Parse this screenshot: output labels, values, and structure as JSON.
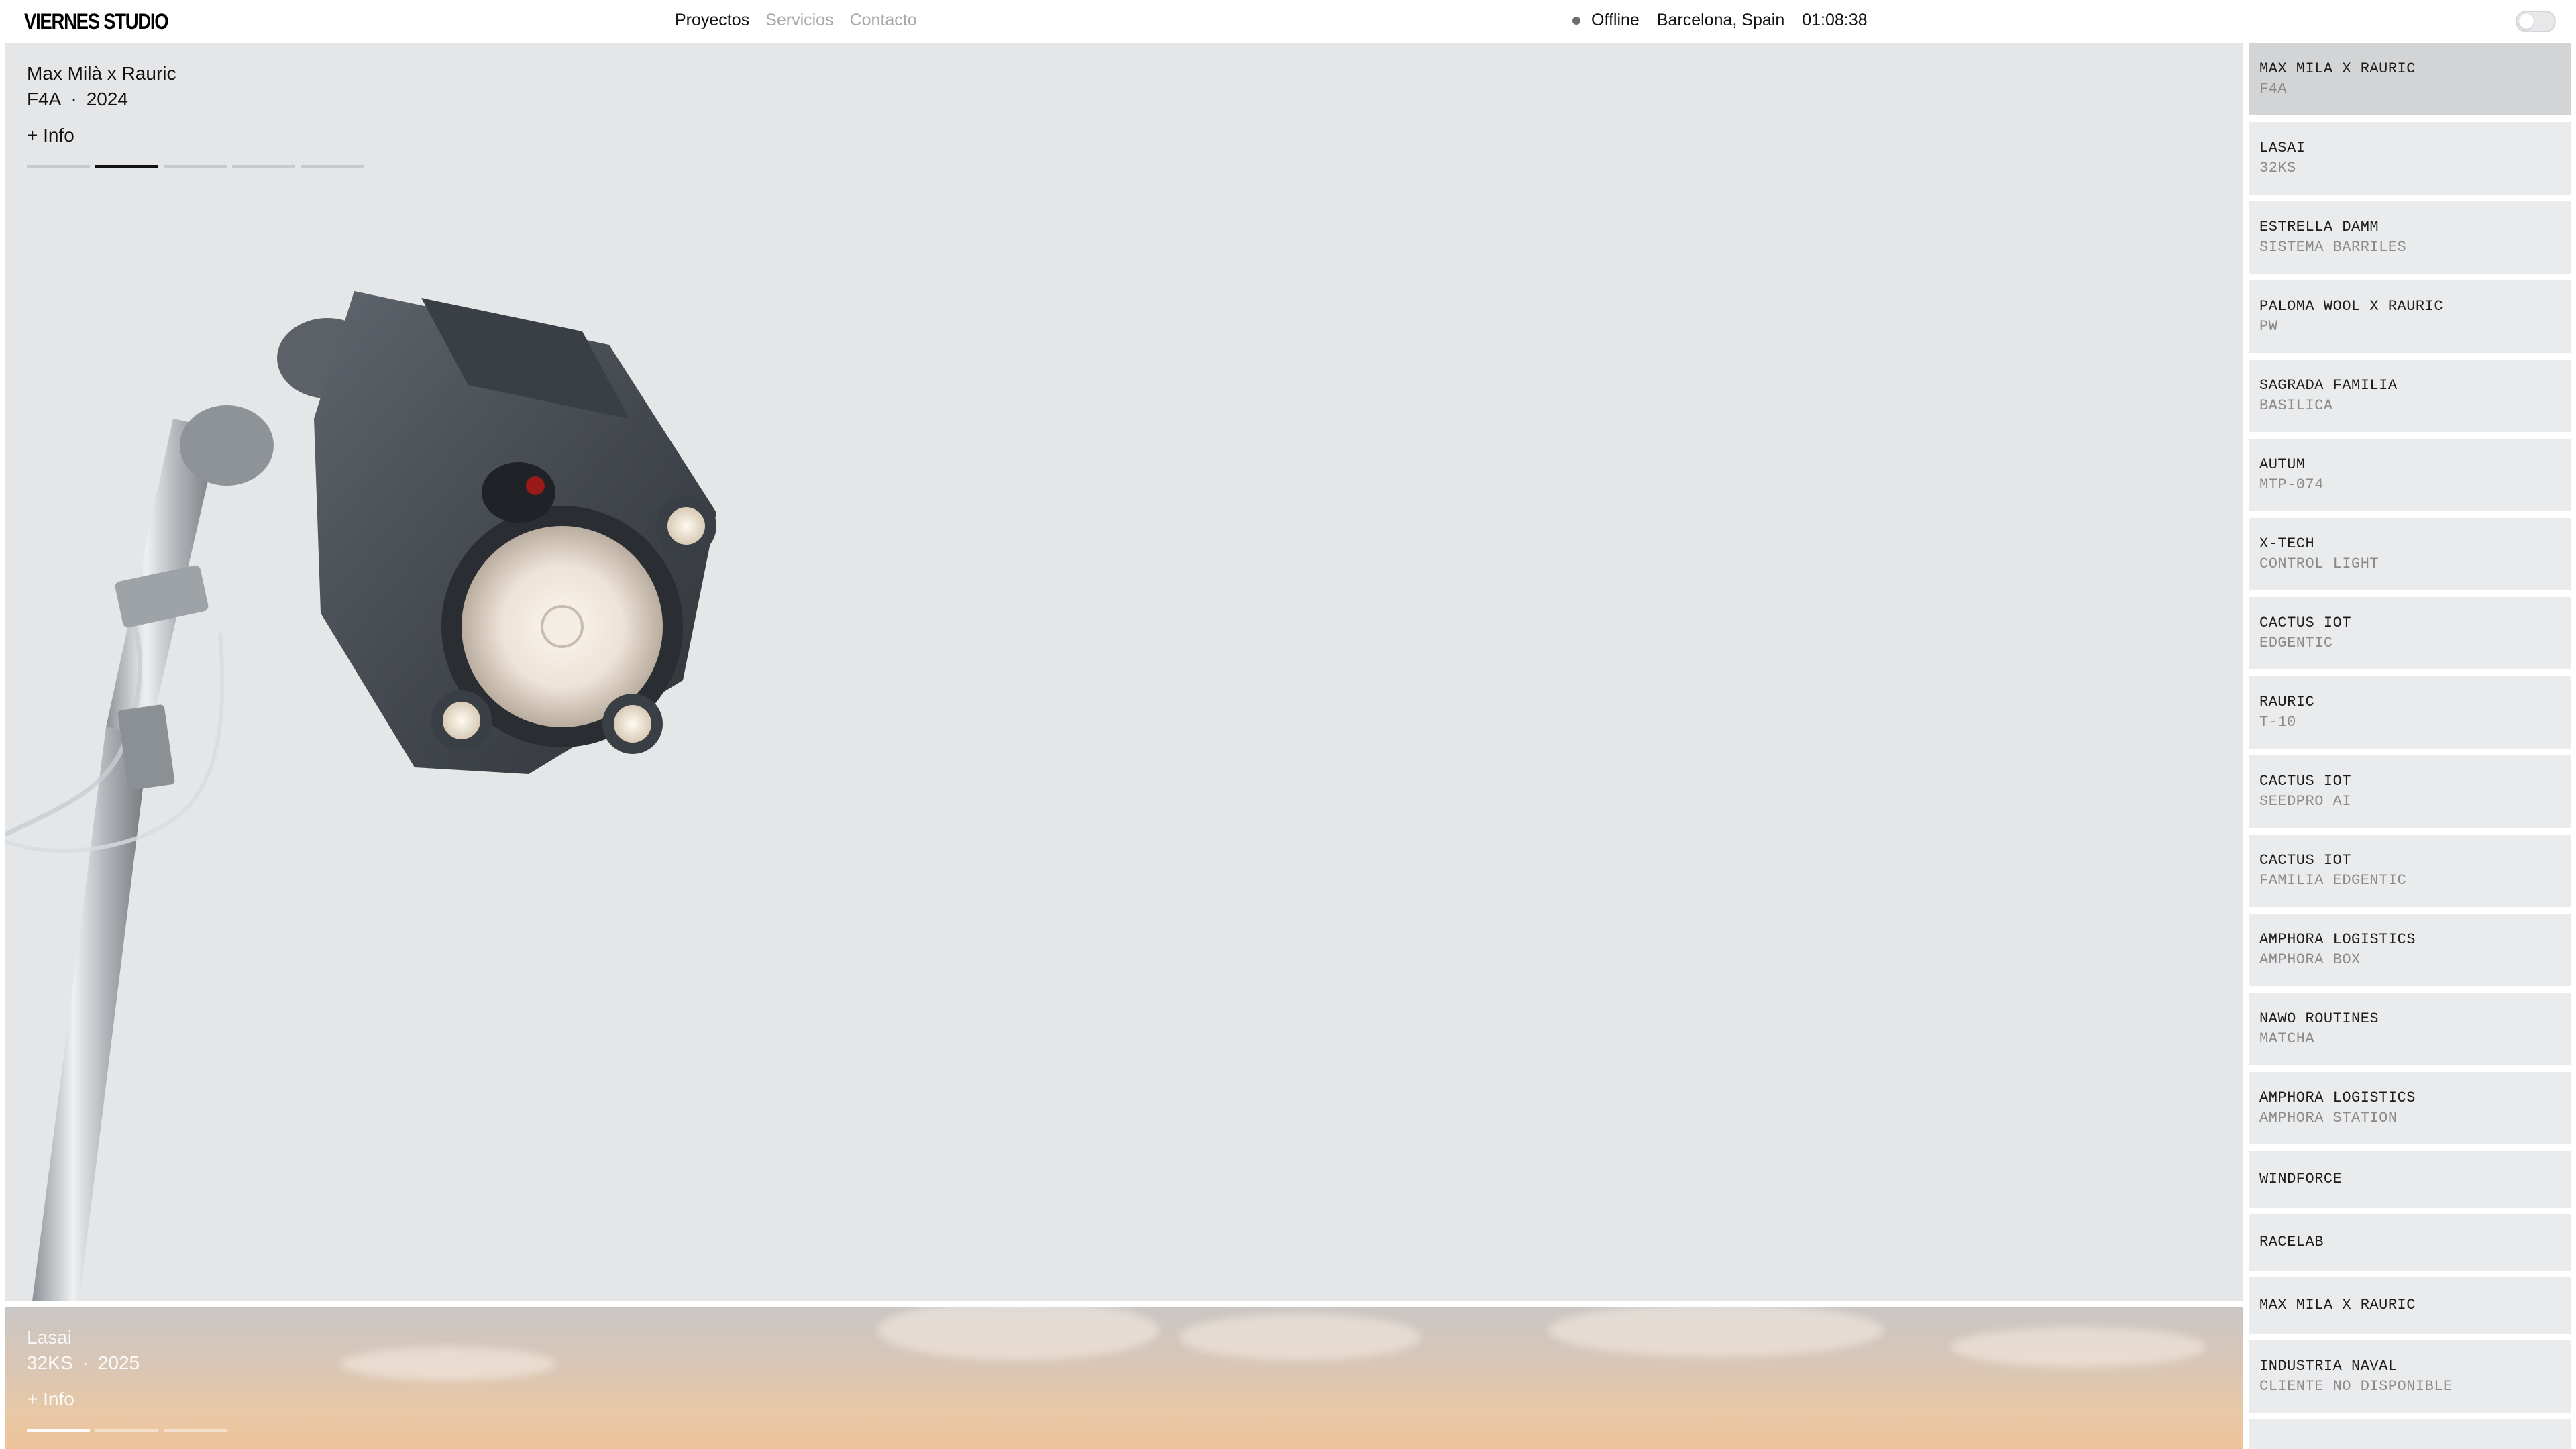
{
  "brand": {
    "logo": "VIERNES STUDIO"
  },
  "nav": {
    "items": [
      {
        "label": "Proyectos",
        "active": true
      },
      {
        "label": "Servicios",
        "active": false
      },
      {
        "label": "Contacto",
        "active": false
      }
    ]
  },
  "status": {
    "state": "Offline",
    "location": "Barcelona, Spain",
    "time": "01:08:38"
  },
  "theme_toggle": {
    "on": false
  },
  "featured": {
    "title": "Max Milà x Rauric",
    "code": "F4A",
    "separator": "·",
    "year": "2024",
    "info_label": "+ Info",
    "slides_total": 5,
    "slide_active": 2
  },
  "next_project": {
    "title": "Lasai",
    "code": "32KS",
    "separator": "·",
    "year": "2025",
    "info_label": "+ Info",
    "slides_total": 3,
    "slide_active": 1
  },
  "sidebar": {
    "items": [
      {
        "name": "MAX MILA X RAURIC",
        "sub": "F4A",
        "active": true
      },
      {
        "name": "LASAI",
        "sub": "32KS"
      },
      {
        "name": "ESTRELLA DAMM",
        "sub": "SISTEMA BARRILES"
      },
      {
        "name": "PALOMA WOOL X RAURIC",
        "sub": "PW"
      },
      {
        "name": "SAGRADA FAMILIA",
        "sub": "BASILICA"
      },
      {
        "name": "AUTUM",
        "sub": "MTP-074"
      },
      {
        "name": "X-TECH",
        "sub": "CONTROL LIGHT"
      },
      {
        "name": "CACTUS IOT",
        "sub": "EDGENTIC"
      },
      {
        "name": "RAURIC",
        "sub": "T-10"
      },
      {
        "name": "CACTUS IOT",
        "sub": "SEEDPRO AI"
      },
      {
        "name": "CACTUS IOT",
        "sub": "FAMILIA EDGENTIC"
      },
      {
        "name": "AMPHORA LOGISTICS",
        "sub": "AMPHORA BOX"
      },
      {
        "name": "NAWO ROUTINES",
        "sub": "MATCHA"
      },
      {
        "name": "AMPHORA LOGISTICS",
        "sub": "AMPHORA STATION"
      },
      {
        "name": "WINDFORCE",
        "sub": ""
      },
      {
        "name": "RACELAB",
        "sub": ""
      },
      {
        "name": "MAX MILA X RAURIC",
        "sub": ""
      },
      {
        "name": "INDUSTRIA NAVAL",
        "sub": "CLIENTE NO DISPONIBLE"
      },
      {
        "name": "",
        "sub": ""
      }
    ]
  },
  "colors": {
    "panel_bg": "#e5e6e8",
    "item_bg": "#eaebec",
    "item_active_bg": "#d3d4d6",
    "muted_text": "#a8a8a8"
  }
}
